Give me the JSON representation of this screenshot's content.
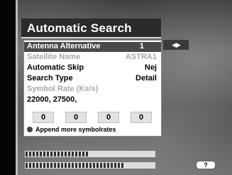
{
  "title": "Automatic Search",
  "rows": [
    {
      "label": "Antenna Alternative",
      "value": "1",
      "state": "selected"
    },
    {
      "label": "Satellite Name",
      "value": "ASTRA1",
      "state": "disabled"
    },
    {
      "label": "Automatic Skip",
      "value": "Nej",
      "state": "normal"
    },
    {
      "label": "Search Type",
      "value": "Detail",
      "state": "normal"
    },
    {
      "label": "Symbol Rate (Ks/s)",
      "value": "",
      "state": "disabled"
    }
  ],
  "symbol_rates_text": "22000, 27500,",
  "symbol_boxes": [
    "0",
    "0",
    "0",
    "0"
  ],
  "append_label": "Append more symbolrates",
  "nav_indicator": "◀▶",
  "help_label": "?",
  "signal_strength_percent": 48,
  "signal_quality_percent": 75,
  "colors": {
    "selected_row": "#4a4a4a",
    "panel": "#ffffff",
    "title_bar": "#2b2b2b"
  }
}
